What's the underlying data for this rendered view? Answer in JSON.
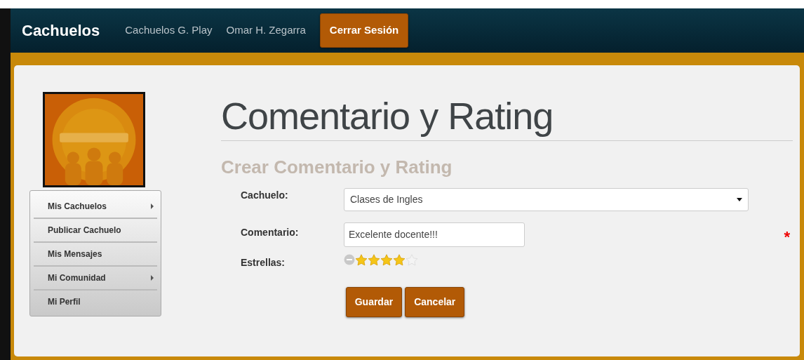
{
  "navbar": {
    "brand": "Cachuelos",
    "links": [
      "Cachuelos G. Play",
      "Omar H. Zegarra"
    ],
    "logout_button": "Cerrar Sesión"
  },
  "sidebar": {
    "items": [
      {
        "label": "Mis Cachuelos",
        "submenu": true
      },
      {
        "label": "Publicar Cachuelo",
        "submenu": false
      },
      {
        "label": "Mis Mensajes",
        "submenu": false
      },
      {
        "label": "Mi Comunidad",
        "submenu": true
      },
      {
        "label": "Mi Perfil",
        "submenu": false
      }
    ]
  },
  "page": {
    "title": "Comentario y Rating",
    "subtitle": "Crear Comentario y Rating"
  },
  "form": {
    "fields": [
      {
        "kind": "select",
        "label": "Cachuelo:",
        "value": "Clases de Ingles"
      },
      {
        "kind": "text",
        "label": "Comentario:",
        "value": "Excelente docente!!!",
        "required_mark": "*"
      },
      {
        "kind": "rating",
        "label": "Estrellas:",
        "stars": 4
      }
    ],
    "buttons": [
      "Guardar",
      "Cancelar"
    ]
  }
}
